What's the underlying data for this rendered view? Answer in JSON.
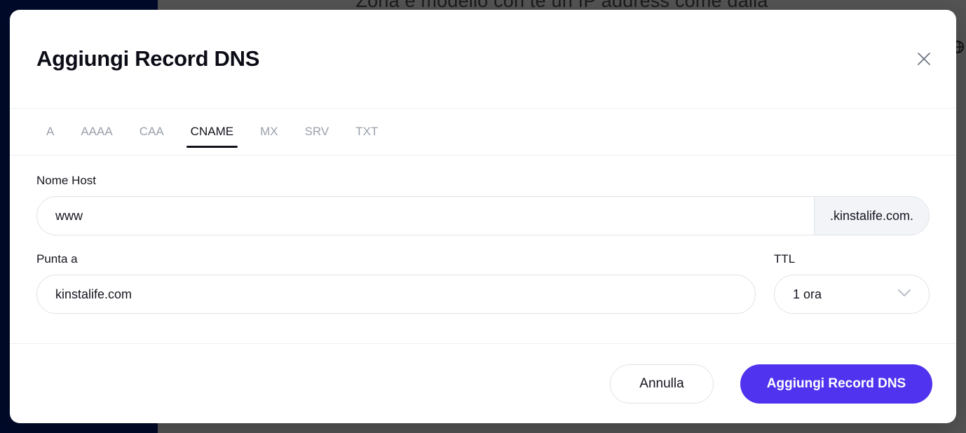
{
  "background": {
    "obscured_text": "Zona e modello con te un IP address come dalla",
    "overlay_color": "#545454",
    "sidebar_color": "#000a29",
    "corner_icon": "globe-icon"
  },
  "modal": {
    "title": "Aggiungi Record DNS",
    "close_icon": "close-icon",
    "tabs": [
      {
        "label": "A",
        "active": false
      },
      {
        "label": "AAAA",
        "active": false
      },
      {
        "label": "CAA",
        "active": false
      },
      {
        "label": "CNAME",
        "active": true
      },
      {
        "label": "MX",
        "active": false
      },
      {
        "label": "SRV",
        "active": false
      },
      {
        "label": "TXT",
        "active": false
      }
    ],
    "form": {
      "hostname": {
        "label": "Nome Host",
        "value": "www",
        "placeholder": "",
        "suffix": ".kinstalife.com."
      },
      "points_to": {
        "label": "Punta a",
        "value": "kinstalife.com",
        "placeholder": ""
      },
      "ttl": {
        "label": "TTL",
        "value": "1 ora",
        "chevron_icon": "chevron-down-icon"
      }
    },
    "footer": {
      "cancel_label": "Annulla",
      "submit_label": "Aggiungi Record DNS"
    }
  },
  "colors": {
    "primary": "#4f33ee",
    "text": "#15151f",
    "muted": "#9aa0ab",
    "border": "#dfe3e9",
    "suffix_bg": "#f2f4f8"
  }
}
